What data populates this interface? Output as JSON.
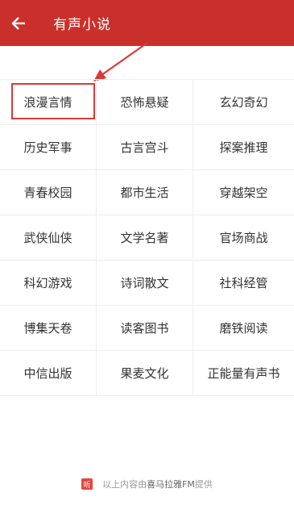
{
  "header": {
    "back_icon": "arrow-left-icon",
    "title": "有声小说",
    "color": "#c9302c"
  },
  "annotation": {
    "color": "#d93a36"
  },
  "categories": [
    "浪漫言情",
    "恐怖悬疑",
    "玄幻奇幻",
    "历史军事",
    "古言宫斗",
    "探案推理",
    "青春校园",
    "都市生活",
    "穿越架空",
    "武侠仙侠",
    "文学名著",
    "官场商战",
    "科幻游戏",
    "诗词散文",
    "社科经管",
    "博集天卷",
    "读客图书",
    "磨铁阅读",
    "中信出版",
    "果麦文化",
    "正能量有声书"
  ],
  "footer": {
    "icon_text": "听",
    "prefix": "以上内容由",
    "brand": "喜马拉雅FM",
    "suffix": "提供"
  }
}
